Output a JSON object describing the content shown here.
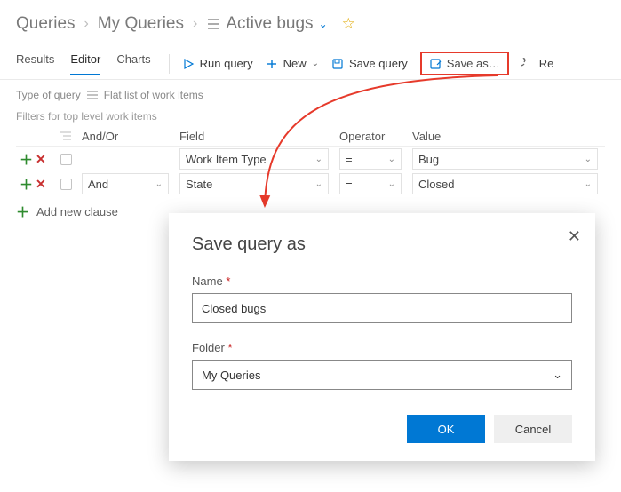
{
  "breadcrumb": {
    "root": "Queries",
    "folder": "My Queries",
    "title": "Active bugs"
  },
  "tabs": {
    "results": "Results",
    "editor": "Editor",
    "charts": "Charts"
  },
  "toolbar": {
    "run": "Run query",
    "new": "New",
    "save": "Save query",
    "saveas": "Save as…",
    "revert": "Re"
  },
  "query_type": {
    "prefix": "Type of query",
    "value": "Flat list of work items"
  },
  "filters": {
    "header": "Filters for top level work items",
    "cols": {
      "andor": "And/Or",
      "field": "Field",
      "operator": "Operator",
      "value": "Value"
    },
    "rows": [
      {
        "andor": "",
        "field": "Work Item Type",
        "operator": "=",
        "value": "Bug"
      },
      {
        "andor": "And",
        "field": "State",
        "operator": "=",
        "value": "Closed"
      }
    ],
    "add": "Add new clause"
  },
  "dialog": {
    "title": "Save query as",
    "name_label": "Name",
    "name_value": "Closed bugs",
    "folder_label": "Folder",
    "folder_value": "My Queries",
    "ok": "OK",
    "cancel": "Cancel"
  }
}
